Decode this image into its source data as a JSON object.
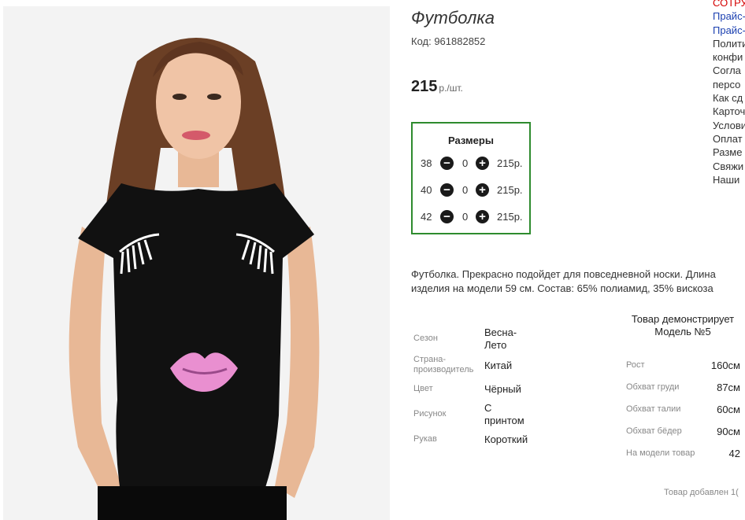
{
  "product": {
    "title": "Футболка",
    "code": "Код: 961882852",
    "price": "215",
    "price_unit": "р./шт."
  },
  "sizes": {
    "title": "Размеры",
    "rows": [
      {
        "size": "38",
        "qty": "0",
        "price": "215р."
      },
      {
        "size": "40",
        "qty": "0",
        "price": "215р."
      },
      {
        "size": "42",
        "qty": "0",
        "price": "215р."
      }
    ]
  },
  "description": "Футболка. Прекрасно подойдет для повседневной носки. Длина изделия на модели 59 см. Состав: 65% полиамид, 35% вискоза",
  "attributes": [
    {
      "label": "Сезон",
      "value": "Весна-Лето"
    },
    {
      "label": "Страна-производитель",
      "value": "Китай"
    },
    {
      "label": "Цвет",
      "value": "Чёрный"
    },
    {
      "label": "Рисунок",
      "value": "С принтом"
    },
    {
      "label": "Рукав",
      "value": "Короткий"
    }
  ],
  "model": {
    "heading_line1": "Товар демонстрирует",
    "heading_line2": "Модель №5",
    "params": [
      {
        "label": "Рост",
        "value": "160см"
      },
      {
        "label": "Обхват груди",
        "value": "87см"
      },
      {
        "label": "Обхват талии",
        "value": "60см"
      },
      {
        "label": "Обхват бёдер",
        "value": "90см"
      },
      {
        "label": "На модели товар",
        "value": "42"
      }
    ]
  },
  "added_text": "Товар добавлен 1(",
  "side_links": [
    {
      "text": "СОТРУ",
      "color": "#d40000"
    },
    {
      "text": "Прайс-",
      "color": "#1a3fb0"
    },
    {
      "text": "Прайс-",
      "color": "#1a3fb0"
    },
    {
      "text": "Полити",
      "color": "#333333"
    },
    {
      "text": "конфи",
      "color": "#333333"
    },
    {
      "text": "Согла",
      "color": "#333333"
    },
    {
      "text": "персо",
      "color": "#333333"
    },
    {
      "text": "Как сд",
      "color": "#333333"
    },
    {
      "text": "Карточ",
      "color": "#333333"
    },
    {
      "text": "Услови",
      "color": "#333333"
    },
    {
      "text": "Оплат",
      "color": "#333333"
    },
    {
      "text": "Разме",
      "color": "#333333"
    },
    {
      "text": "Свяжи",
      "color": "#333333"
    },
    {
      "text": "Наши",
      "color": "#333333"
    }
  ],
  "colors": {
    "sizes_border": "#2e8b2e",
    "tshirt": "#111111",
    "lips": "#e98fd0"
  }
}
